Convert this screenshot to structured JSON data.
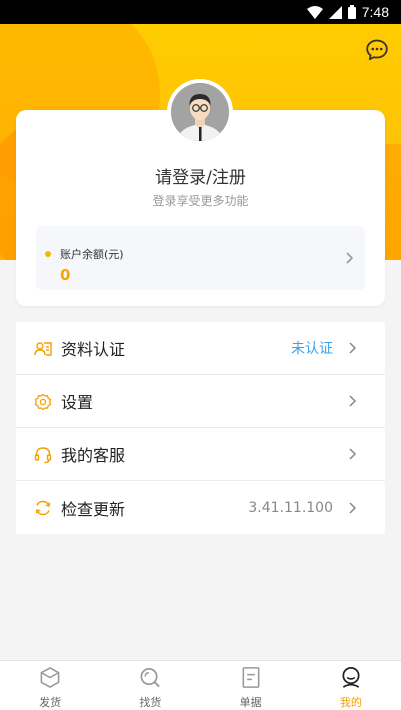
{
  "status_bar": {
    "time": "7:48"
  },
  "profile": {
    "login_title": "请登录/注册",
    "login_subtitle": "登录享受更多功能"
  },
  "balance": {
    "label": "账户余额(元)",
    "value": "0"
  },
  "menu": [
    {
      "label": "资料认证",
      "value": "未认证",
      "icon": "id-card-icon"
    },
    {
      "label": "设置",
      "value": "",
      "icon": "gear-icon"
    },
    {
      "label": "我的客服",
      "value": "",
      "icon": "headset-icon"
    },
    {
      "label": "检查更新",
      "value": "3.41.11.100",
      "icon": "refresh-icon"
    }
  ],
  "bottom_nav": [
    {
      "label": "发货",
      "icon": "cube-icon"
    },
    {
      "label": "找货",
      "icon": "search-icon"
    },
    {
      "label": "单据",
      "icon": "document-icon"
    },
    {
      "label": "我的",
      "icon": "user-icon"
    }
  ],
  "colors": {
    "accent": "#f7a600",
    "header": "#ffc107",
    "link_blue": "#3aa3e8"
  }
}
